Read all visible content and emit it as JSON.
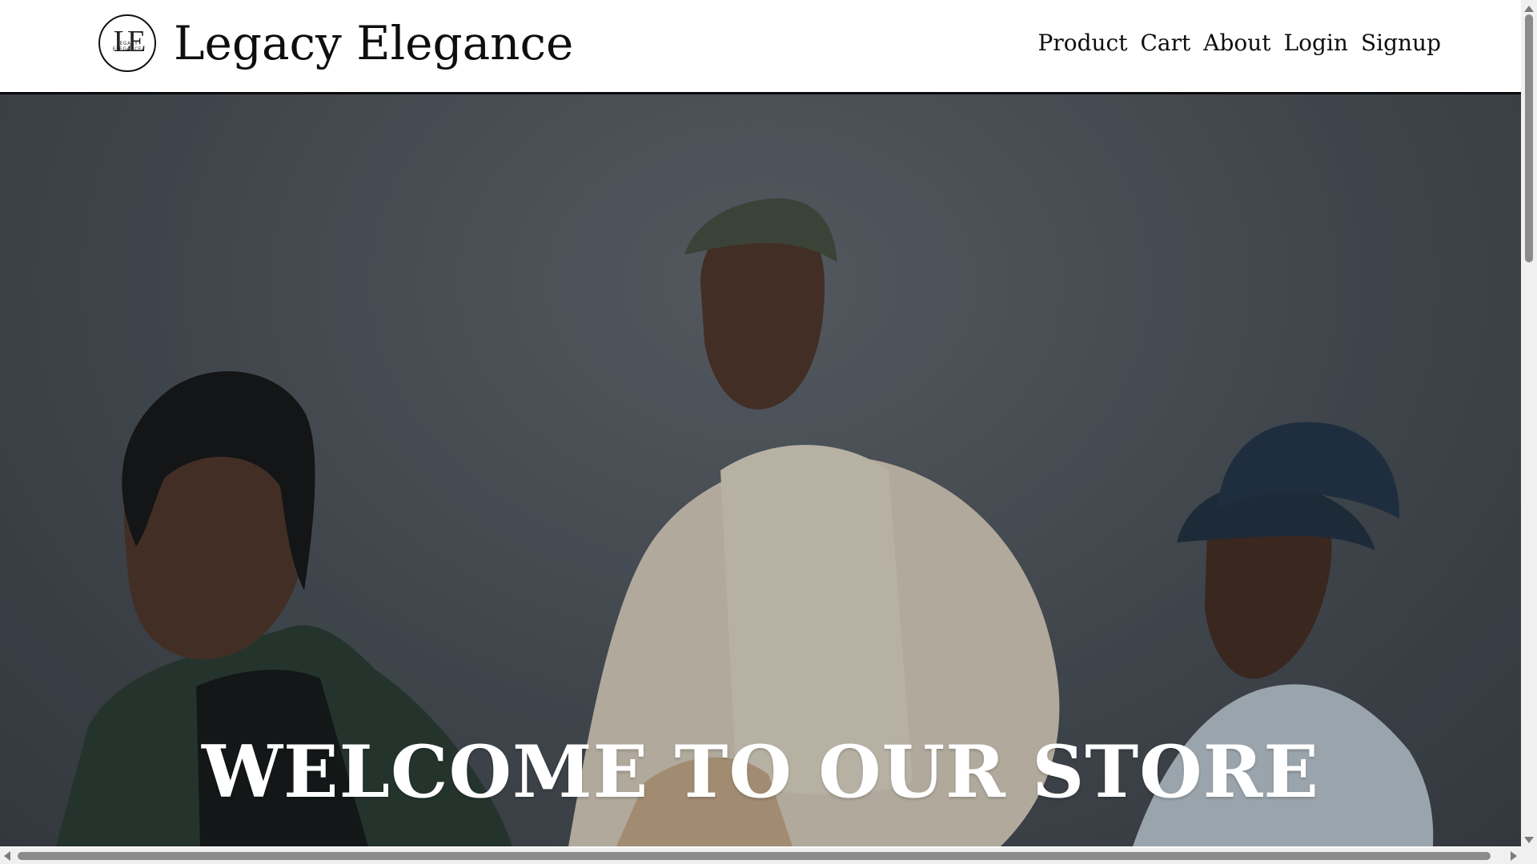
{
  "brand": {
    "name": "Legacy Elegance",
    "logo_monogram": "LE",
    "logo_ring_text": "LEGACY ELEGANCE"
  },
  "nav": {
    "items": [
      {
        "label": "Product"
      },
      {
        "label": "Cart"
      },
      {
        "label": "About"
      },
      {
        "label": "Login"
      },
      {
        "label": "Signup"
      }
    ]
  },
  "hero": {
    "title": "WELCOME TO OUR STORE"
  }
}
